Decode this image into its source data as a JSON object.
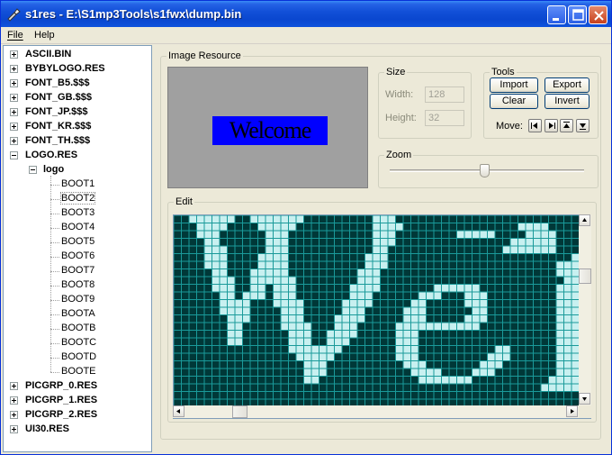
{
  "window": {
    "title": "s1res - E:\\S1mp3Tools\\s1fwx\\dump.bin"
  },
  "menu": {
    "file": "File",
    "help": "Help"
  },
  "tree": {
    "top_items_a": [
      "ASCII.BIN",
      "BYBYLOGO.RES",
      "FONT_B5.$$$",
      "FONT_GB.$$$",
      "FONT_JP.$$$",
      "FONT_KR.$$$",
      "FONT_TH.$$$",
      "LOGO.RES"
    ],
    "logo_child": "logo",
    "leaves": [
      "BOOT1",
      "BOOT2",
      "BOOT3",
      "BOOT4",
      "BOOT5",
      "BOOT6",
      "BOOT7",
      "BOOT8",
      "BOOT9",
      "BOOTA",
      "BOOTB",
      "BOOTC",
      "BOOTD",
      "BOOTE"
    ],
    "selected_leaf": "BOOT2",
    "top_items_b": [
      "PICGRP_0.RES",
      "PICGRP_1.RES",
      "PICGRP_2.RES",
      "UI30.RES"
    ]
  },
  "image_resource": {
    "title": "Image Resource",
    "preview_text": "Welcome"
  },
  "size": {
    "title": "Size",
    "width_label": "Width:",
    "width_value": "128",
    "height_label": "Height:",
    "height_value": "32"
  },
  "tools": {
    "title": "Tools",
    "import": "Import",
    "export": "Export",
    "clear": "Clear",
    "invert": "Invert",
    "move_label": "Move:"
  },
  "zoom": {
    "title": "Zoom",
    "level": 0.5
  },
  "edit": {
    "title": "Edit"
  },
  "colors": {
    "accent": "#0a47cf",
    "pixel_on": "#c8f0f0",
    "pixel_off": "#003838",
    "grid": "#1a9a9a",
    "preview_bg": "#0000ff"
  }
}
